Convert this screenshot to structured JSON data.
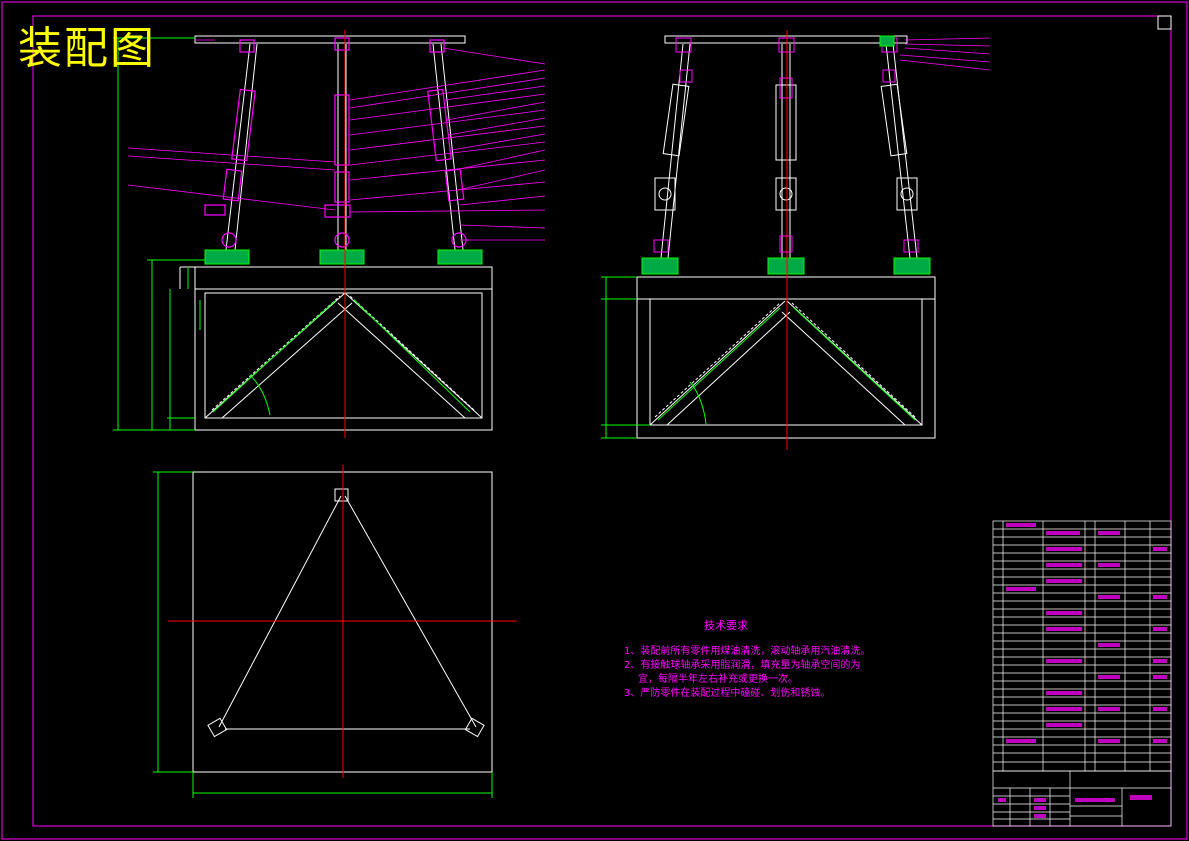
{
  "drawing_title": "装配图",
  "tech_requirements": {
    "heading": "技术要求",
    "items": [
      "1、装配前所有零件用煤油清洗，滚动轴承用汽油清洗。",
      "2、有接触球轴承采用脂润滑，填充量为轴承空间的为",
      "宜，每隔半年左右补充或更换一次。",
      "3、严防零件在装配过程中磕碰、划伤和锈蚀。"
    ]
  },
  "colors": {
    "background": "#000000",
    "border": "#ff00ff",
    "outline": "#ffffff",
    "dimension": "#00ff00",
    "centerline": "#ff0000",
    "leader": "#ff00ff",
    "title_text": "#ffff00"
  }
}
